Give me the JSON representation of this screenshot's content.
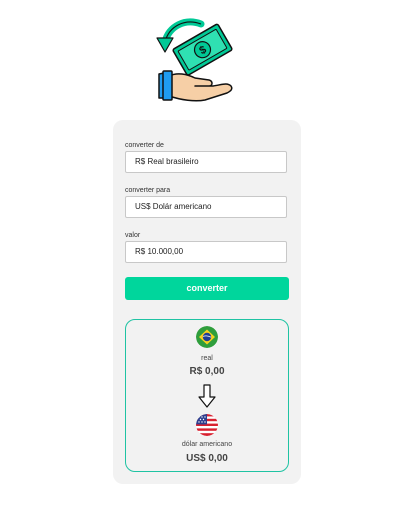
{
  "form": {
    "from_label": "converter de",
    "from_value": "R$ Real brasileiro",
    "to_label": "converter para",
    "to_value": "US$ Dolár americano",
    "amount_label": "valor",
    "amount_value": "R$ 10.000,00",
    "button_label": "converter"
  },
  "result": {
    "from_name": "real",
    "from_value": "R$ 0,00",
    "to_name": "dólar americano",
    "to_value": "US$ 0,00"
  },
  "icons": {
    "logo": "money-exchange-hand-icon",
    "from_flag": "brazil-flag-icon",
    "arrow": "arrow-down-icon",
    "to_flag": "usa-flag-icon"
  },
  "colors": {
    "accent": "#00d69c",
    "result_border": "#1fc3a3",
    "card_background": "#f2f2f2",
    "logo_green": "#00c996"
  }
}
